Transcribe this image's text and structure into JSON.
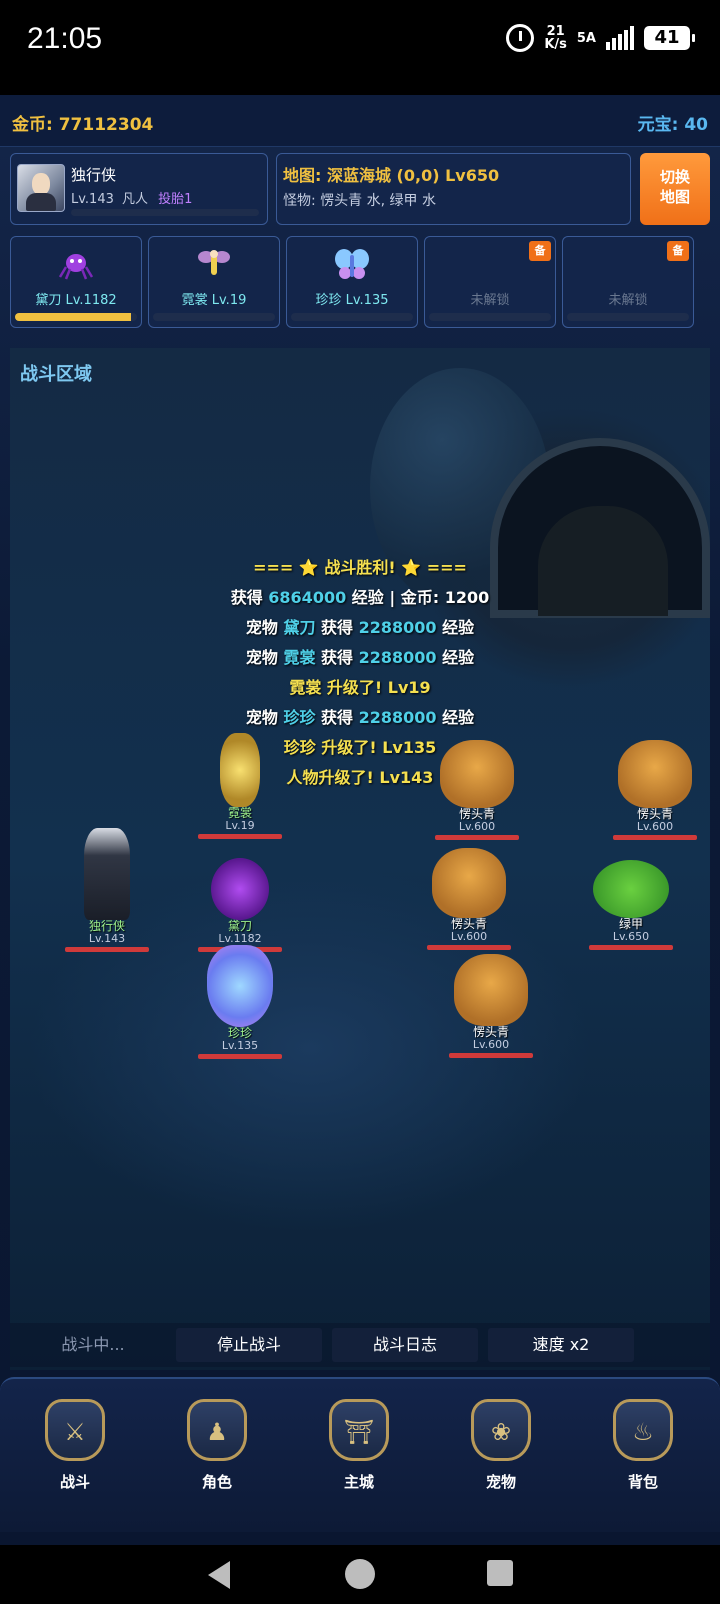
{
  "status_bar": {
    "time": "21:05",
    "net_speed": "21",
    "net_unit": "K/s",
    "net_type": "5A",
    "battery": "41"
  },
  "header": {
    "gold_label": "金币: 77112304",
    "yuanbao_label": "元宝: 40"
  },
  "player": {
    "name": "独行侠",
    "level": "Lv.143",
    "rank": "凡人",
    "reborn": "投胎1"
  },
  "map": {
    "line1": "地图:  深蓝海城 (0,0)   Lv650",
    "line2": "怪物:  愣头青 水, 绿甲 水",
    "switch_label": "切换\n地图"
  },
  "pets": [
    {
      "label": "黛刀 Lv.1182",
      "locked": false,
      "progress": 0.95
    },
    {
      "label": "霓裳 Lv.19",
      "locked": false,
      "progress": 0
    },
    {
      "label": "珍珍 Lv.135",
      "locked": false,
      "progress": 0
    },
    {
      "label": "未解锁",
      "locked": true,
      "badge": "备"
    },
    {
      "label": "未解锁",
      "locked": true,
      "badge": "备"
    }
  ],
  "battle": {
    "title": "战斗区域",
    "log": {
      "l1": "=== ⭐ 战斗胜利! ⭐ ===",
      "l2a": "获得 ",
      "l2b": "6864000",
      "l2c": " 经验 | 金币: 1200",
      "l3a": "宠物 ",
      "l3b": "黛刀",
      "l3c": " 获得 ",
      "l3d": "2288000",
      "l3e": " 经验",
      "l4a": "宠物 ",
      "l4b": "霓裳",
      "l4c": " 获得 ",
      "l4d": "2288000",
      "l4e": " 经验",
      "l5": "霓裳 升级了! Lv19",
      "l6a": "宠物 ",
      "l6b": "珍珍",
      "l6c": " 获得 ",
      "l6d": "2288000",
      "l6e": " 经验",
      "l7": "珍珍 升级了! Lv135",
      "l8": "人物升级了! Lv143"
    },
    "units": {
      "fairy": {
        "name": "霓裳",
        "lv": "Lv.19"
      },
      "warrior": {
        "name": "独行侠",
        "lv": "Lv.143"
      },
      "spider": {
        "name": "黛刀",
        "lv": "Lv.1182"
      },
      "butterfly": {
        "name": "珍珍",
        "lv": "Lv.135"
      },
      "seal1": {
        "name": "愣头青",
        "lv": "Lv.600"
      },
      "seal2": {
        "name": "愣头青",
        "lv": "Lv.600"
      },
      "seal3": {
        "name": "愣头青",
        "lv": "Lv.600"
      },
      "seal4": {
        "name": "愣头青",
        "lv": "Lv.600"
      },
      "crab": {
        "name": "绿甲",
        "lv": "Lv.650"
      }
    },
    "controls": {
      "status": "战斗中...",
      "stop": "停止战斗",
      "log": "战斗日志",
      "speed": "速度 x2"
    }
  },
  "nav": {
    "battle": "战斗",
    "role": "角色",
    "city": "主城",
    "pet": "宠物",
    "bag": "背包"
  }
}
